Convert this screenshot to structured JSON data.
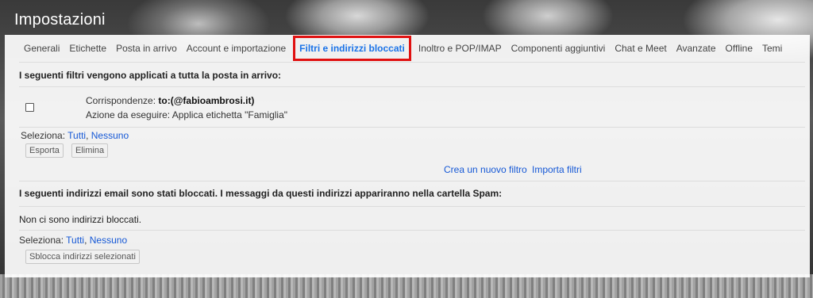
{
  "window": {
    "title": "Impostazioni"
  },
  "tabs": [
    {
      "label": "Generali"
    },
    {
      "label": "Etichette"
    },
    {
      "label": "Posta in arrivo"
    },
    {
      "label": "Account e importazione"
    },
    {
      "label": "Filtri e indirizzi bloccati",
      "active": true
    },
    {
      "label": "Inoltro e POP/IMAP"
    },
    {
      "label": "Componenti aggiuntivi"
    },
    {
      "label": "Chat e Meet"
    },
    {
      "label": "Avanzate"
    },
    {
      "label": "Offline"
    },
    {
      "label": "Temi"
    }
  ],
  "filters": {
    "heading": "I seguenti filtri vengono applicati a tutta la posta in arrivo:",
    "rows": [
      {
        "match_label": "Corrispondenze:",
        "match_value": "to:(@fabioambrosi.it)",
        "action_label": "Azione da eseguire:",
        "action_value": "Applica etichetta \"Famiglia\""
      }
    ],
    "select_label": "Seleziona:",
    "select_all": "Tutti",
    "select_none": "Nessuno",
    "export_button": "Esporta",
    "delete_button": "Elimina",
    "create_link": "Crea un nuovo filtro",
    "import_link": "Importa filtri"
  },
  "blocked": {
    "heading": "I seguenti indirizzi email sono stati bloccati. I messaggi da questi indirizzi appariranno nella cartella Spam:",
    "empty_text": "Non ci sono indirizzi bloccati.",
    "select_label": "Seleziona:",
    "select_all": "Tutti",
    "select_none": "Nessuno",
    "unblock_button": "Sblocca indirizzi selezionati"
  },
  "colors": {
    "accent": "#1a73e8",
    "highlight_border": "#e01010",
    "link": "#1558d6"
  }
}
